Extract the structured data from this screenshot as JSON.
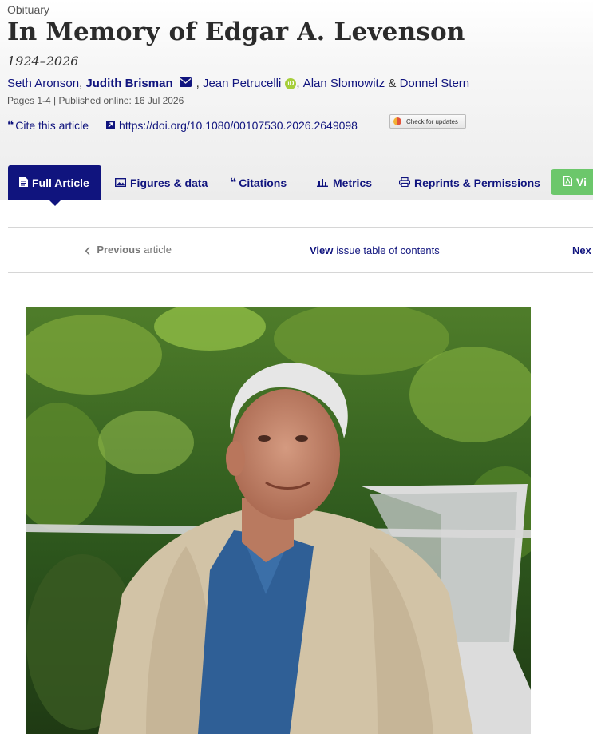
{
  "article": {
    "type": "Obituary",
    "title": "In Memory of Edgar A. Levenson",
    "subtitle": "1924–2026",
    "authors": [
      "Seth Aronson",
      "Judith Brisman",
      "Jean Petrucelli",
      "Alan Slomowitz",
      "Donnel Stern"
    ],
    "separators": {
      "comma": ",",
      "amp": "&"
    },
    "orcid_label": "iD",
    "meta": "Pages 1-4 | Published online: 16 Jul 2026"
  },
  "tools": {
    "cite_label": "Cite this article",
    "doi": "https://doi.org/10.1080/00107530.2026.2649098",
    "check_updates": "Check for updates"
  },
  "tabs": {
    "full_article": "Full Article",
    "figures": "Figures & data",
    "citations": "Citations",
    "metrics": "Metrics",
    "reprints": "Reprints & Permissions",
    "pdf": "Vi"
  },
  "article_nav": {
    "prev_bold": "Previous",
    "prev_rest": "article",
    "issue_bold": "View",
    "issue_rest": "issue table of contents",
    "next": "Nex"
  },
  "colors": {
    "brand": "#10147e",
    "pdf_button": "#6cc76b",
    "orcid": "#a6ce39"
  }
}
